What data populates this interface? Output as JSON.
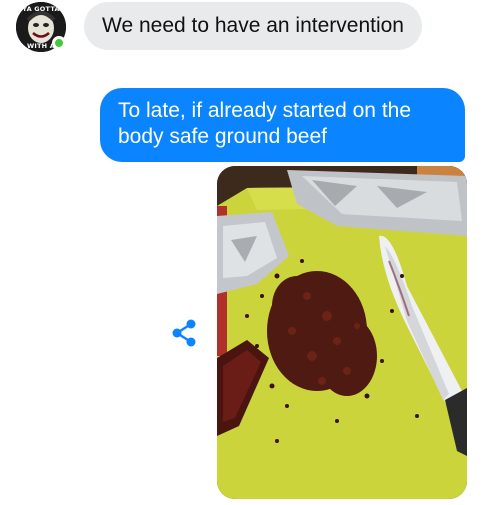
{
  "contact": {
    "avatar_top_text": "YA GOTTA",
    "avatar_bottom_text": "WITH A",
    "online_color": "#44c93b"
  },
  "messages": [
    {
      "direction": "incoming",
      "text": "We need to have an intervention"
    },
    {
      "direction": "outgoing",
      "text": "To late, if already started on the body safe ground beef"
    }
  ],
  "attachment": {
    "type": "photo",
    "share_icon": "share-icon"
  },
  "colors": {
    "outgoing_bubble": "#0b84ff",
    "incoming_bubble": "#e9eaeb",
    "share_icon": "#0b84ff"
  }
}
